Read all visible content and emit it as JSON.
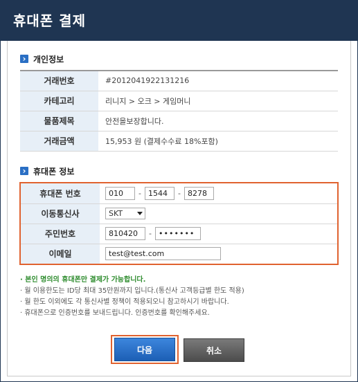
{
  "header": {
    "title": "휴대폰 결제"
  },
  "personal": {
    "section_title": "개인정보",
    "rows": [
      {
        "label": "거래번호",
        "value": "#2012041922131216"
      },
      {
        "label": "카테고리",
        "value": "리니지 > 오크 > 게임머니"
      },
      {
        "label": "물품제목",
        "value": "안전을보장합니다."
      },
      {
        "label": "거래금액",
        "value": "15,953 원 (결제수수료 18%포함)"
      }
    ]
  },
  "phone": {
    "section_title": "휴대폰 정보",
    "number_label": "휴대폰 번호",
    "number": [
      "010",
      "1544",
      "8278"
    ],
    "carrier_label": "이동통신사",
    "carrier_selected": "SKT",
    "rrn_label": "주민번호",
    "rrn_front": "810420",
    "rrn_back": "•••••••",
    "email_label": "이메일",
    "email": "test@test.com"
  },
  "notes": [
    "· 본인 명의의 휴대폰만 결제가 가능합니다.",
    "· 월 이용한도는 ID당 최대 35만원까지 입니다.(통신사 고객등급별 한도 적용)",
    "· 월 한도 이외에도 각 통신사별 정책이 적용되오니 참고하시기 바랍니다.",
    "· 휴대폰으로 인증번호를 보내드립니다. 인증번호를 확인해주세요."
  ],
  "buttons": {
    "next": "다음",
    "cancel": "취소"
  },
  "colors": {
    "header_bg": "#1f3552",
    "highlight": "#e0622f",
    "label_bg": "#e7eff7",
    "notice_green": "#2e8c2e",
    "primary": "#2a6fc4"
  }
}
